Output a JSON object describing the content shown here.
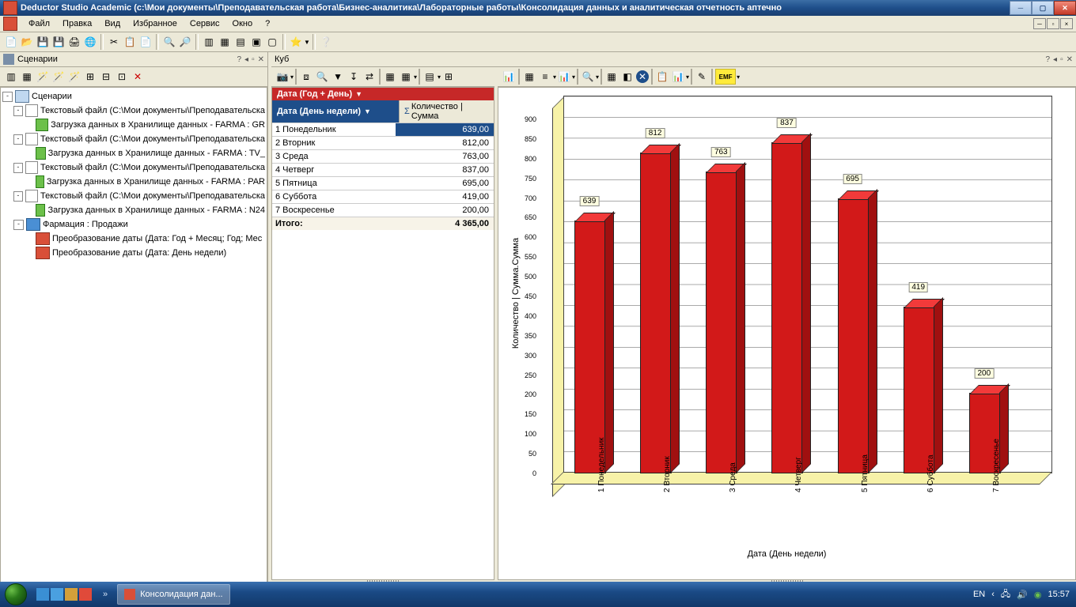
{
  "title": "Deductor Studio Academic (c:\\Мои документы\\Преподавательская работа\\Бизнес-аналитика\\Лабораторные работы\\Консолидация данных и аналитическая отчетность аптечно",
  "menu": {
    "file": "Файл",
    "edit": "Правка",
    "view": "Вид",
    "fav": "Избранное",
    "svc": "Сервис",
    "win": "Окно",
    "help": "?"
  },
  "panels": {
    "scen": "Сценарии",
    "cube": "Куб"
  },
  "tree": {
    "root": "Сценарии",
    "n1": "Текстовый файл (C:\\Мои документы\\Преподавательска",
    "n1a": "Загрузка данных в Хранилище данных - FARMA : GR",
    "n2": "Текстовый файл (C:\\Мои документы\\Преподавательска",
    "n2a": "Загрузка данных в Хранилище данных - FARMA : TV_",
    "n3": "Текстовый файл (C:\\Мои документы\\Преподавательска",
    "n3a": "Загрузка данных в Хранилище данных - FARMA : PAR",
    "n4": "Текстовый файл (C:\\Мои документы\\Преподавательска",
    "n4a": "Загрузка данных в Хранилище данных - FARMA : N24",
    "n5": "Фармация : Продажи",
    "n5a": "Преобразование даты (Дата: Год + Месяц; Год; Мес",
    "n5b": "Преобразование даты (Дата: День недели)"
  },
  "pivot": {
    "rowhdr": "Дата (Год + День)",
    "colhdr": "Дата (День недели)",
    "measure": "Количество | Сумма",
    "sigma": "Σ",
    "rows": [
      {
        "k": "1 Понедельник",
        "v": "639,00"
      },
      {
        "k": "2 Вторник",
        "v": "812,00"
      },
      {
        "k": "3 Среда",
        "v": "763,00"
      },
      {
        "k": "4 Четверг",
        "v": "837,00"
      },
      {
        "k": "5 Пятница",
        "v": "695,00"
      },
      {
        "k": "6 Суббота",
        "v": "419,00"
      },
      {
        "k": "7 Воскресенье",
        "v": "200,00"
      }
    ],
    "total_k": "Итого:",
    "total_v": "4 365,00"
  },
  "chart_data": {
    "type": "bar",
    "categories": [
      "1 Понедельник",
      "2 Вторник",
      "3 Среда",
      "4 Четверг",
      "5 Пятница",
      "6 Суббота",
      "7 Воскресенье"
    ],
    "values": [
      639,
      812,
      763,
      837,
      695,
      419,
      200
    ],
    "xlabel": "Дата (День недели)",
    "ylabel": "Количество | Сумма.Сумма",
    "ylim": [
      0,
      900
    ],
    "yticks": [
      0,
      50,
      100,
      150,
      200,
      250,
      300,
      350,
      400,
      450,
      500,
      550,
      600,
      650,
      700,
      750,
      800,
      850,
      900
    ]
  },
  "taskbar": {
    "app": "Консолидация дан...",
    "lang": "EN",
    "time": "15:57"
  }
}
